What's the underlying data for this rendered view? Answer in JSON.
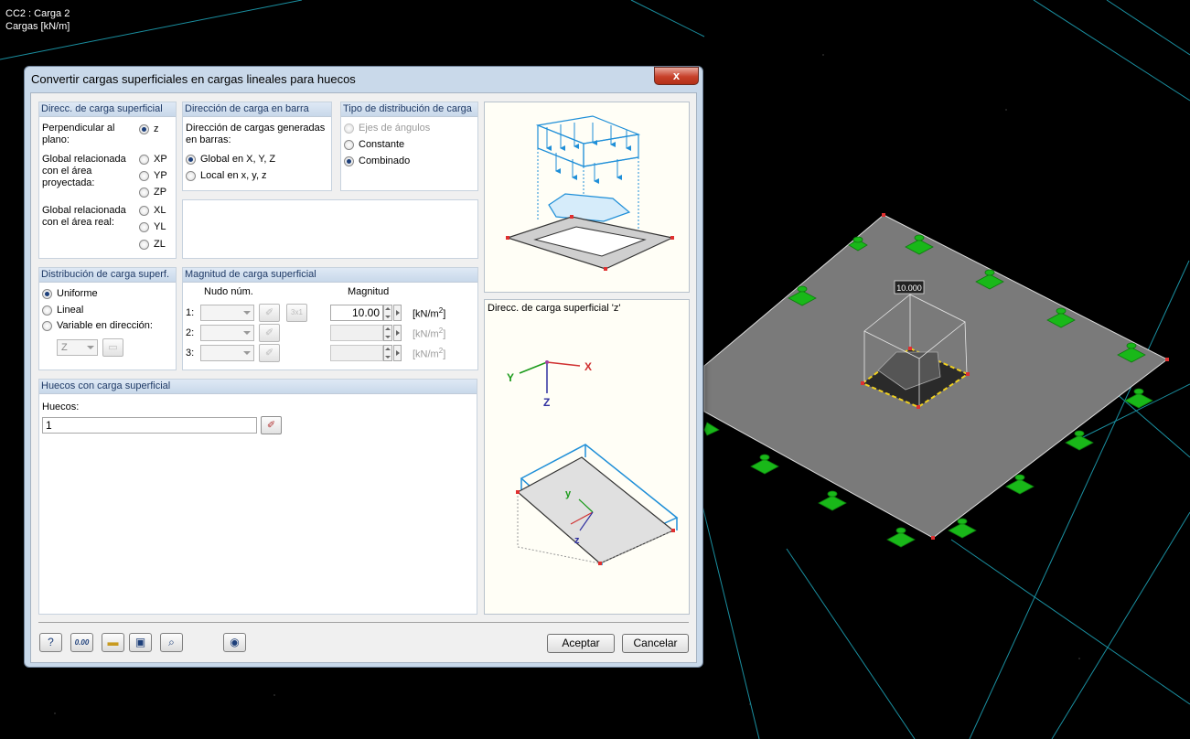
{
  "viewport": {
    "info_line1": "CC2 : Carga 2",
    "info_line2": "Cargas [kN/m]",
    "load_value_label": "10.000"
  },
  "dialog": {
    "title": "Convertir cargas superficiales en cargas lineales para huecos",
    "close_label": "x",
    "dir_surface": {
      "title": "Direcc. de carga superficial",
      "perp_label": "Perpendicular al plano:",
      "perp_option": "z",
      "global_proj_label": "Global relacionada con el área proyectada:",
      "proj_options": [
        "XP",
        "YP",
        "ZP"
      ],
      "global_real_label": "Global relacionada con el área real:",
      "real_options": [
        "XL",
        "YL",
        "ZL"
      ],
      "selected": "z"
    },
    "dir_bar": {
      "title": "Dirección de carga en barra",
      "desc": "Dirección de cargas generadas en barras:",
      "options": [
        "Global en X, Y, Z",
        "Local en x, y, z"
      ],
      "selected": "Global en X, Y, Z"
    },
    "dist_type": {
      "title": "Tipo de distribución de carga",
      "options": [
        "Ejes de ángulos",
        "Constante",
        "Combinado"
      ],
      "selected": "Combinado"
    },
    "surface_dist": {
      "title": "Distribución de carga superf.",
      "options": [
        "Uniforme",
        "Lineal",
        "Variable en dirección:"
      ],
      "selected": "Uniforme",
      "direction_value": "Z"
    },
    "magnitude": {
      "title": "Magnitud de carga superficial",
      "col_node": "Nudo núm.",
      "col_mag": "Magnitud",
      "rows": [
        {
          "label": "1:",
          "value": "10.00",
          "unit_prefix": "[kN/m",
          "unit_exp": "2",
          "unit_suffix": "]"
        },
        {
          "label": "2:",
          "value": "",
          "unit_prefix": "[kN/m",
          "unit_exp": "2",
          "unit_suffix": "]"
        },
        {
          "label": "3:",
          "value": "",
          "unit_prefix": "[kN/m",
          "unit_exp": "2",
          "unit_suffix": "]"
        }
      ],
      "pick_label": "3x1"
    },
    "openings": {
      "title": "Huecos con carga superficial",
      "label": "Huecos:",
      "value": "1"
    },
    "preview_caption": "Direcc. de carga superficial 'z'",
    "axes": {
      "x": "X",
      "y": "Y",
      "z": "Z",
      "lx": "y",
      "lz": "z"
    },
    "toolbar": {
      "units_label": "0.00"
    },
    "ok_label": "Aceptar",
    "cancel_label": "Cancelar"
  },
  "colors": {
    "accent_blue": "#1d3f7a",
    "load_blue": "#1f8fd8",
    "support_green": "#1fc21f",
    "grid_cyan": "#1aa0b0"
  }
}
